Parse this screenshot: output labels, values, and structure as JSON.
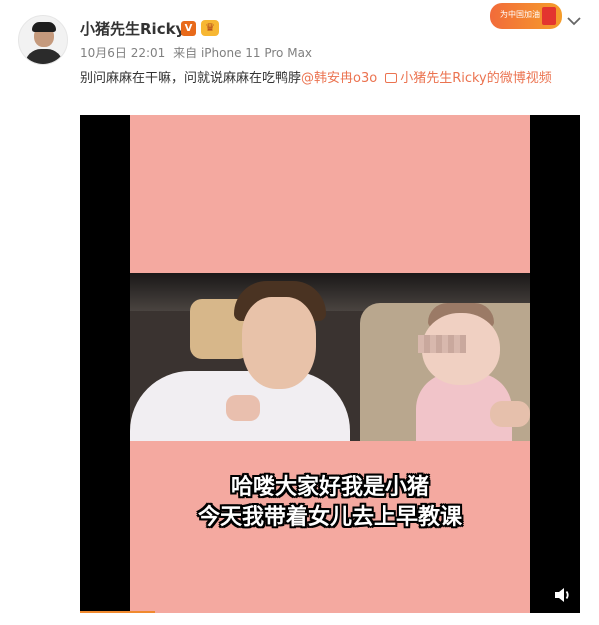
{
  "user": {
    "name": "小猪先生Ricky",
    "verified_badge": "V",
    "vip_icon": "crown-icon"
  },
  "banner": {
    "text": "为中国加油"
  },
  "meta": {
    "date": "10月6日 22:01",
    "source": "来自 iPhone 11 Pro Max"
  },
  "post": {
    "text": "别问麻麻在干嘛，问就说麻麻在吃鸭脖",
    "mention": "@韩安冉o3o",
    "video_link": "小猪先生Ricky的微博视频"
  },
  "video": {
    "caption_line1": "哈喽大家好我是小猪",
    "caption_line2": "今天我带着女儿去上早教课",
    "progress_percent": 15
  },
  "colors": {
    "accent": "#eb7350",
    "verified": "#e86a1a",
    "video_bg": "#f4a9a0"
  }
}
